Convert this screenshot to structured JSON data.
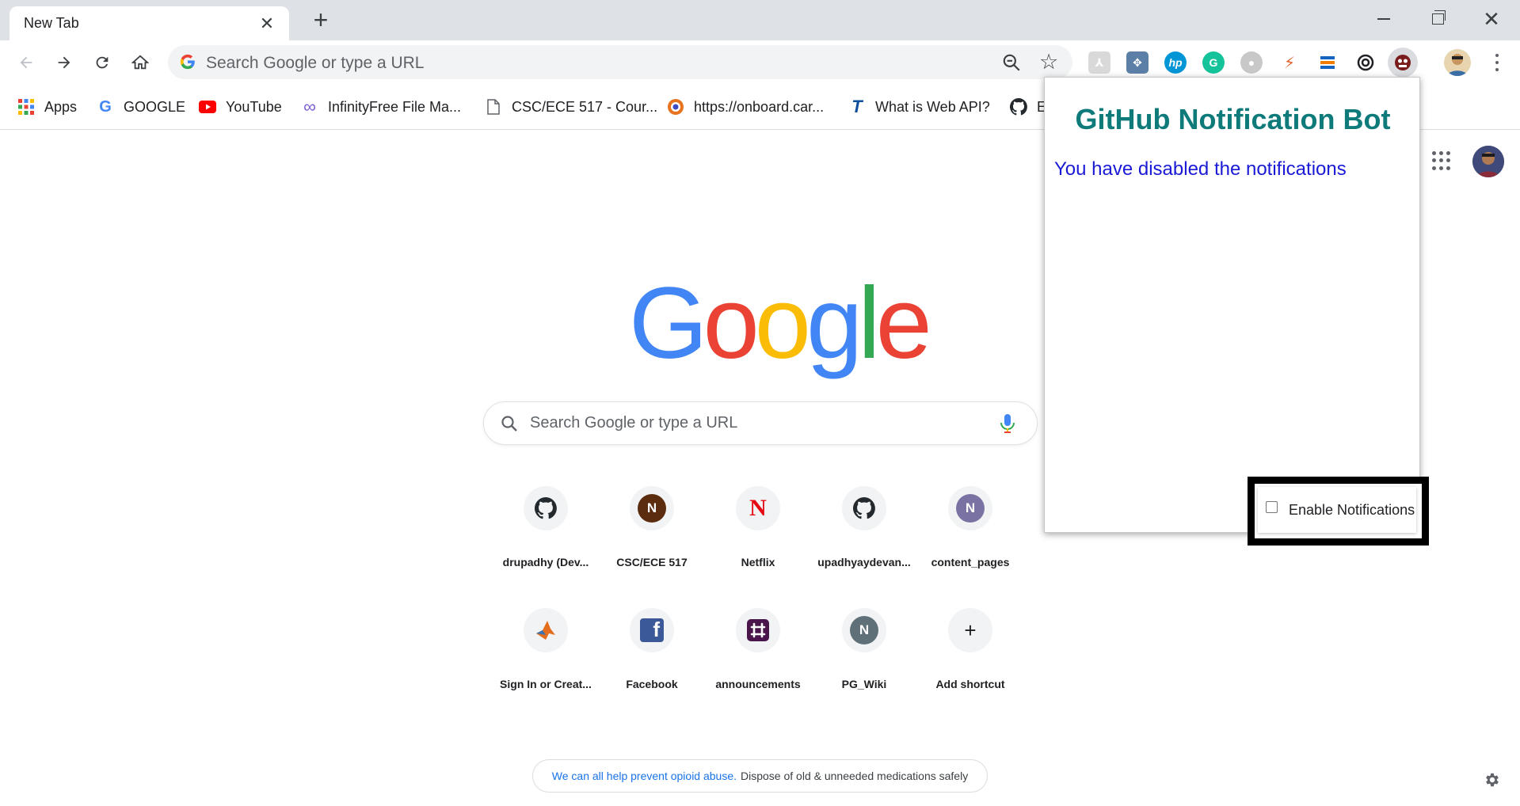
{
  "browser": {
    "tab_title": "New Tab",
    "omnibox_placeholder": "Search Google or type a URL"
  },
  "bookmarks": [
    {
      "label": "Apps",
      "icon": "apps-grid-icon"
    },
    {
      "label": "GOOGLE",
      "icon": "google-g-icon"
    },
    {
      "label": "YouTube",
      "icon": "youtube-icon"
    },
    {
      "label": "InfinityFree File Ma...",
      "icon": "infinity-icon"
    },
    {
      "label": "CSC/ECE 517 - Cour...",
      "icon": "page-icon"
    },
    {
      "label": "https://onboard.car...",
      "icon": "onboard-icon"
    },
    {
      "label": "What is Web API?",
      "icon": "tutorials-teacher-icon"
    },
    {
      "label": "E",
      "icon": "github-icon"
    }
  ],
  "ntp": {
    "logo_letters": [
      "G",
      "o",
      "o",
      "g",
      "l",
      "e"
    ],
    "search_placeholder": "Search Google or type a URL",
    "tiles": [
      {
        "label": "drupadhy (Dev...",
        "letter": "",
        "color": "#24292e"
      },
      {
        "label": "CSC/ECE 517",
        "letter": "N",
        "color": "#5b2c0e"
      },
      {
        "label": "Netflix",
        "letter": "N",
        "color": "#e50914"
      },
      {
        "label": "upadhyaydevan...",
        "letter": "",
        "color": "#24292e"
      },
      {
        "label": "content_pages",
        "letter": "N",
        "color": "#7a72a3"
      },
      {
        "label": "Sign In or Creat...",
        "letter": "",
        "color": "#e36e1e"
      },
      {
        "label": "Facebook",
        "letter": "f",
        "color": "#3b5998"
      },
      {
        "label": "announcements",
        "letter": "",
        "color": "#4a154b"
      },
      {
        "label": "PG_Wiki",
        "letter": "N",
        "color": "#5f7078"
      },
      {
        "label": "Add shortcut",
        "letter": "+",
        "color": "#f1f3f4"
      }
    ],
    "promo_link": "We can all help prevent opioid abuse.",
    "promo_text": "Dispose of old & unneeded medications safely"
  },
  "popup": {
    "title": "GitHub Notification Bot",
    "message": "You have disabled the notifications",
    "checkbox_label": "Enable Notifications",
    "checkbox_checked": false
  },
  "colors": {
    "popup_title": "#0e7a7a",
    "popup_message": "#1a1ad6",
    "accent": "#1a73e8"
  }
}
